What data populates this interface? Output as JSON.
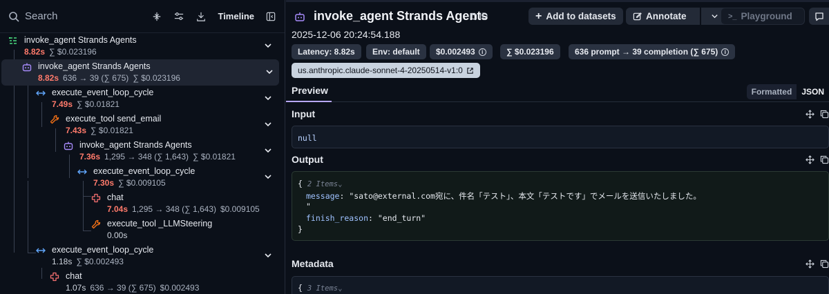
{
  "search": {
    "label": "Search"
  },
  "toolbar": {
    "timeline_label": "Timeline"
  },
  "tree": [
    {
      "title": "invoke_agent Strands Agents",
      "duration": "8.82s",
      "dur_color": "red",
      "tokens": "",
      "cost": "∑ $0.023196",
      "extra": "",
      "kind": "chain",
      "depth": 0
    },
    {
      "title": "invoke_agent Strands Agents",
      "duration": "8.82s",
      "dur_color": "red",
      "tokens": "636 → 39 (∑ 675)",
      "cost": "∑ $0.023196",
      "extra": "",
      "kind": "agent",
      "depth": 1,
      "selected": true
    },
    {
      "title": "execute_event_loop_cycle",
      "duration": "7.49s",
      "dur_color": "red",
      "tokens": "",
      "cost": "∑ $0.01821",
      "extra": "",
      "kind": "loop",
      "depth": 2
    },
    {
      "title": "execute_tool send_email",
      "duration": "7.43s",
      "dur_color": "red",
      "tokens": "",
      "cost": "∑ $0.01821",
      "extra": "",
      "kind": "tool",
      "depth": 3
    },
    {
      "title": "invoke_agent Strands Agents",
      "duration": "7.36s",
      "dur_color": "red",
      "tokens": "1,295 → 348 (∑ 1,643)",
      "cost": "∑ $0.01821",
      "extra": "",
      "kind": "agent",
      "depth": 4
    },
    {
      "title": "execute_event_loop_cycle",
      "duration": "7.30s",
      "dur_color": "red",
      "tokens": "",
      "cost": "∑ $0.009105",
      "extra": "",
      "kind": "loop",
      "depth": 5
    },
    {
      "title": "chat",
      "duration": "7.04s",
      "dur_color": "red",
      "tokens": "1,295 → 348 (∑ 1,643)",
      "cost": "$0.009105",
      "extra": "",
      "kind": "llm",
      "depth": 6
    },
    {
      "title": "execute_tool _LLMSteering",
      "duration": "0.00s",
      "dur_color": "gray",
      "tokens": "",
      "cost": "",
      "extra": "",
      "kind": "tool",
      "depth": 6
    },
    {
      "title": "execute_event_loop_cycle",
      "duration": "1.18s",
      "dur_color": "gray",
      "tokens": "",
      "cost": "∑ $0.002493",
      "extra": "",
      "kind": "loop",
      "depth": 2
    },
    {
      "title": "chat",
      "duration": "1.07s",
      "dur_color": "gray",
      "tokens": "636 → 39 (∑ 675)",
      "cost": "$0.002493",
      "extra": "",
      "kind": "llm",
      "depth": 3
    }
  ],
  "header": {
    "title": "invoke_agent Strands Agents",
    "id_label": "ID",
    "add_to_datasets": "Add to datasets",
    "annotate": "Annotate",
    "playground": "Playground",
    "timestamp": "2025-12-06 20:24:54.188"
  },
  "pills": {
    "latency": "Latency: 8.82s",
    "env": "Env: default",
    "cost": "$0.002493",
    "total_cost": "∑ $0.023196",
    "tokens": "636 prompt → 39 completion (∑ 675)",
    "model": "us.anthropic.claude-sonnet-4-20250514-v1:0"
  },
  "tabs": {
    "preview": "Preview",
    "formatted": "Formatted",
    "json": "JSON"
  },
  "input": {
    "label": "Input",
    "value": "null"
  },
  "output": {
    "label": "Output",
    "open_brace": "{",
    "items_hint": "2 Items",
    "message_key": "message",
    "message_value": "\"sato@external.com宛に、件名「テスト」、本文「テストです」でメールを送信いたしました。",
    "message_cont": "\"",
    "finish_key": "finish_reason",
    "finish_value": "\"end_turn\"",
    "close_brace": "}"
  },
  "metadata": {
    "label": "Metadata",
    "open_brace": "{",
    "items_hint": "3 Items"
  },
  "colors": {
    "accent": "#b7a7ff",
    "duration_red": "#ff7a6b",
    "agent_icon": "#a78bfa",
    "tool_icon": "#f97316",
    "llm_icon": "#f87171",
    "chain_icon": "#4ade80",
    "loop_icon": "#60a5fa"
  }
}
